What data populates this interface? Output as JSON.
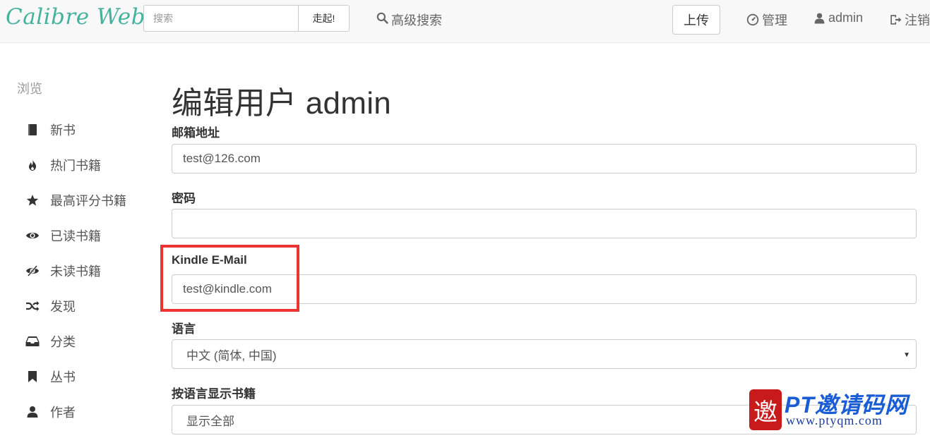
{
  "navbar": {
    "brand": "Calibre Web",
    "search_placeholder": "搜索",
    "search_button": "走起!",
    "advanced_search": "高级搜索",
    "upload": "上传",
    "admin_settings": "管理",
    "user": "admin",
    "logout": "注销"
  },
  "sidebar": {
    "header": "浏览",
    "items": [
      {
        "label": "新书",
        "icon": "book-icon"
      },
      {
        "label": "热门书籍",
        "icon": "fire-icon"
      },
      {
        "label": "最高评分书籍",
        "icon": "star-icon"
      },
      {
        "label": "已读书籍",
        "icon": "eye-icon"
      },
      {
        "label": "未读书籍",
        "icon": "eye-slash-icon"
      },
      {
        "label": "发现",
        "icon": "random-icon"
      },
      {
        "label": "分类",
        "icon": "inbox-icon"
      },
      {
        "label": "丛书",
        "icon": "bookmark-icon"
      },
      {
        "label": "作者",
        "icon": "user-icon"
      }
    ]
  },
  "main": {
    "title": "编辑用户 admin",
    "fields": {
      "email": {
        "label": "邮箱地址",
        "value": "test@126.com"
      },
      "password": {
        "label": "密码",
        "value": ""
      },
      "kindle": {
        "label": "Kindle E-Mail",
        "value": "test@kindle.com"
      },
      "language": {
        "label": "语言",
        "value": "中文 (简体, 中国)"
      },
      "book_language": {
        "label": "按语言显示书籍",
        "value": "显示全部"
      }
    }
  },
  "watermark": {
    "seal": "邀",
    "title": "PT邀请码网",
    "url": "www.ptyqm.com"
  },
  "colors": {
    "brand": "#45b29d",
    "highlight": "#ee3333",
    "watermark_blue": "#1a5cd6"
  }
}
